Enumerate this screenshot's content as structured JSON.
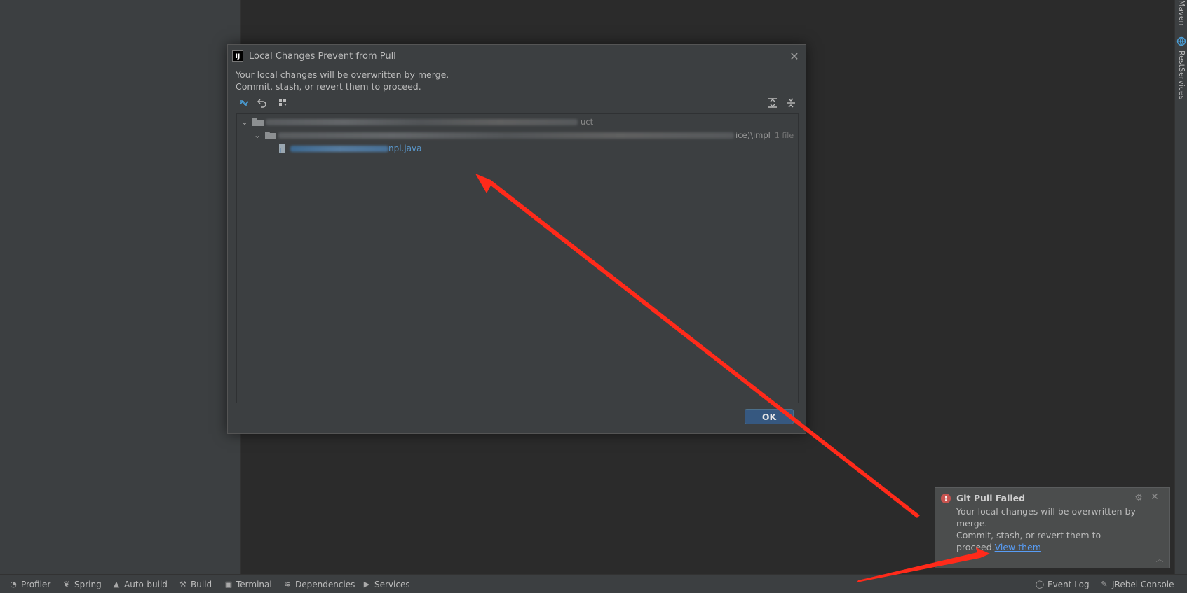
{
  "right_strip": {
    "maven_label": "Maven",
    "rest_label": "RestServices"
  },
  "dialog": {
    "title": "Local Changes Prevent from Pull",
    "message_line1": "Your local changes will be overwritten by merge.",
    "message_line2": "Commit, stash, or revert them to proceed.",
    "tree": {
      "root_suffix": "uct",
      "sub_suffix": "ice)\\impl",
      "sub_count": "1 file",
      "file_suffix": "npl.java"
    },
    "ok_label": "OK"
  },
  "notification": {
    "title": "Git Pull Failed",
    "body_line1": "Your local changes will be overwritten by",
    "body_line2": "merge.",
    "body_line3": "Commit, stash, or revert them to",
    "body_line4": "proceed.",
    "link_label": "View them"
  },
  "statusbar": {
    "profiler": "Profiler",
    "spring": "Spring",
    "autobuild": "Auto-build",
    "build": "Build",
    "terminal": "Terminal",
    "dependencies": "Dependencies",
    "services": "Services",
    "event_log": "Event Log",
    "jrebel_console": "JRebel Console"
  },
  "colors": {
    "annotation_arrow": "#ff2a1a",
    "link": "#589df6",
    "error": "#c75450"
  }
}
